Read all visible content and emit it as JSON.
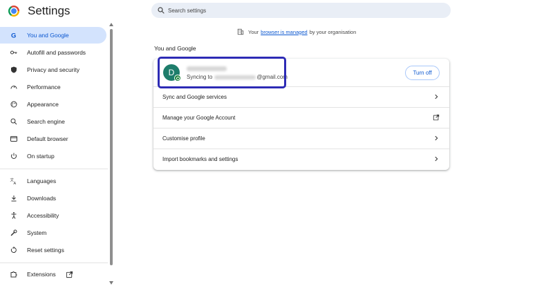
{
  "header": {
    "title": "Settings",
    "search_placeholder": "Search settings"
  },
  "sidebar": {
    "items": [
      {
        "label": "You and Google",
        "icon": "google-g-icon",
        "active": true
      },
      {
        "label": "Autofill and passwords",
        "icon": "key-icon"
      },
      {
        "label": "Privacy and security",
        "icon": "shield-icon"
      },
      {
        "label": "Performance",
        "icon": "speedometer-icon"
      },
      {
        "label": "Appearance",
        "icon": "palette-icon"
      },
      {
        "label": "Search engine",
        "icon": "search-icon"
      },
      {
        "label": "Default browser",
        "icon": "browser-window-icon"
      },
      {
        "label": "On startup",
        "icon": "power-icon"
      },
      {
        "label": "Languages",
        "icon": "translate-icon"
      },
      {
        "label": "Downloads",
        "icon": "download-icon"
      },
      {
        "label": "Accessibility",
        "icon": "accessibility-icon"
      },
      {
        "label": "System",
        "icon": "wrench-icon"
      },
      {
        "label": "Reset settings",
        "icon": "reset-icon"
      },
      {
        "label": "Extensions",
        "icon": "puzzle-icon"
      }
    ],
    "extensions_link_icon": "external-link-icon"
  },
  "main": {
    "managed_notice": {
      "prefix": "Your",
      "link": "browser is managed",
      "suffix": "by your organisation"
    },
    "section_title": "You and Google",
    "account": {
      "avatar_letter": "D",
      "sync_prefix": "Syncing to",
      "email_domain": "@gmail.com",
      "turn_off_label": "Turn off"
    },
    "rows": [
      {
        "label": "Sync and Google services",
        "trail_icon": "chevron-right-icon"
      },
      {
        "label": "Manage your Google Account",
        "trail_icon": "external-link-icon"
      },
      {
        "label": "Customise profile",
        "trail_icon": "chevron-right-icon"
      },
      {
        "label": "Import bookmarks and settings",
        "trail_icon": "chevron-right-icon"
      }
    ]
  },
  "colors": {
    "accent": "#0b57d0",
    "active_nav_bg": "#d3e3fd",
    "highlight_box": "#2d2bb5",
    "avatar_bg": "#1e7d6b"
  }
}
